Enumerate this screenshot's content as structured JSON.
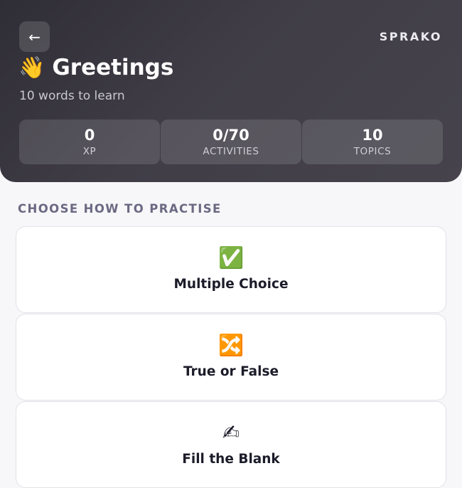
{
  "header": {
    "back_icon": "←",
    "brand": "SPRAKO",
    "title_icon": "👋",
    "title": "Greetings",
    "subtitle": "10 words to learn",
    "stats": [
      {
        "value": "0",
        "label": "XP"
      },
      {
        "value": "0/70",
        "label": "ACTIVITIES"
      },
      {
        "value": "10",
        "label": "TOPICS"
      }
    ]
  },
  "main": {
    "section_heading": "CHOOSE HOW TO PRACTISE",
    "modes": [
      {
        "icon": "✅",
        "icon_name": "check-mark-icon",
        "label": "Multiple Choice"
      },
      {
        "icon": "🔀",
        "icon_name": "shuffle-icon",
        "label": "True or False"
      },
      {
        "icon": "✍",
        "icon_name": "writing-hand-icon",
        "label": "Fill the Blank"
      }
    ]
  },
  "colors": {
    "header_gradient_start": "#2f2d35",
    "header_gradient_end": "#46434c",
    "background": "#f7f7f9",
    "section_heading": "#6b6982"
  }
}
